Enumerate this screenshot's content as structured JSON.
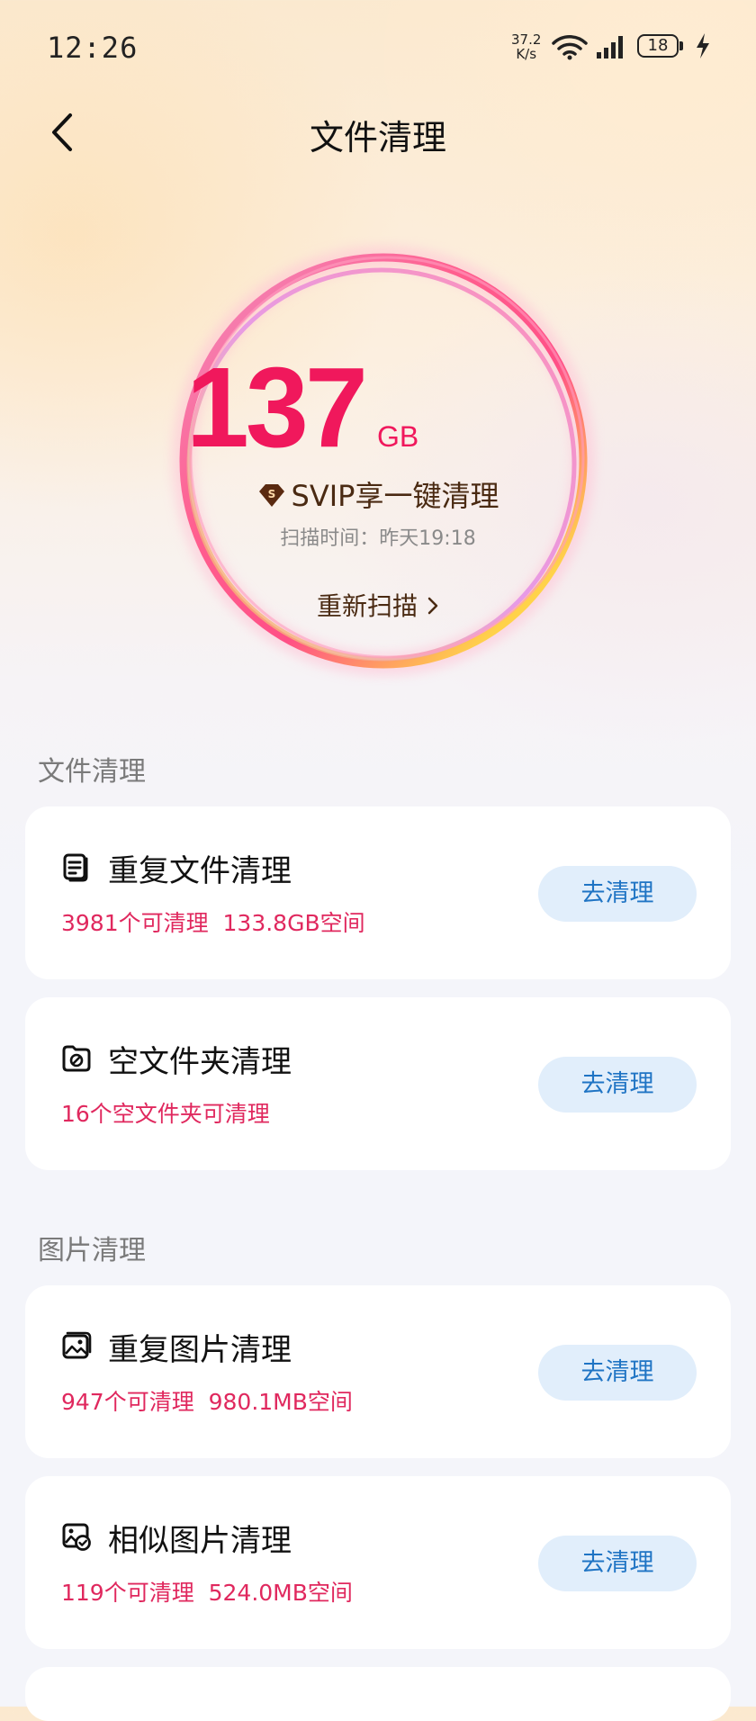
{
  "status_bar": {
    "time": "12:26",
    "net_speed_value": "37.2",
    "net_speed_unit": "K/s",
    "battery": "18"
  },
  "header": {
    "title": "文件清理",
    "back_icon": "chevron-left-icon"
  },
  "summary": {
    "amount": "137",
    "unit": "GB",
    "svip_label": "SVIP享一键清理",
    "scan_time": "扫描时间：昨天19:18",
    "rescan_label": "重新扫描",
    "accent_color": "#f0185c"
  },
  "sections": [
    {
      "title": "文件清理",
      "items": [
        {
          "name": "重复文件清理",
          "desc": "3981个可清理  133.8GB空间",
          "button": "去清理",
          "icon": "document-icon"
        },
        {
          "name": "空文件夹清理",
          "desc": "16个空文件夹可清理",
          "button": "去清理",
          "icon": "empty-folder-icon"
        }
      ]
    },
    {
      "title": "图片清理",
      "items": [
        {
          "name": "重复图片清理",
          "desc": "947个可清理  980.1MB空间",
          "button": "去清理",
          "icon": "image-icon"
        },
        {
          "name": "相似图片清理",
          "desc": "119个可清理  524.0MB空间",
          "button": "去清理",
          "icon": "similar-image-icon"
        }
      ]
    }
  ],
  "colors": {
    "desc_text": "#e0285e",
    "button_bg": "#e1eefb",
    "button_text": "#1f74c4"
  }
}
